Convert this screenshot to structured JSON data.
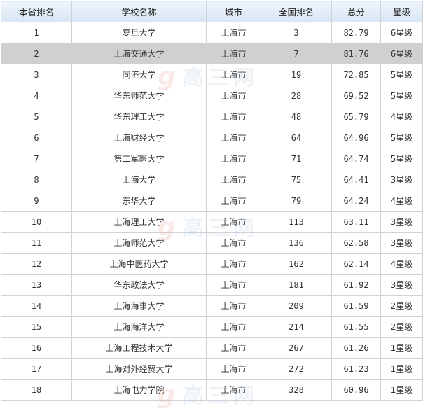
{
  "table": {
    "headers": [
      "本省排名",
      "学校名称",
      "城市",
      "全国排名",
      "总分",
      "星级"
    ],
    "rows": [
      {
        "prov": "1",
        "name": "复旦大学",
        "city": "上海市",
        "nat": "3",
        "score": "82.79",
        "star": "6星级"
      },
      {
        "prov": "2",
        "name": "上海交通大学",
        "city": "上海市",
        "nat": "7",
        "score": "81.76",
        "star": "6星级"
      },
      {
        "prov": "3",
        "name": "同济大学",
        "city": "上海市",
        "nat": "19",
        "score": "72.85",
        "star": "5星级"
      },
      {
        "prov": "4",
        "name": "华东师范大学",
        "city": "上海市",
        "nat": "28",
        "score": "69.52",
        "star": "5星级"
      },
      {
        "prov": "5",
        "name": "华东理工大学",
        "city": "上海市",
        "nat": "48",
        "score": "65.79",
        "star": "4星级"
      },
      {
        "prov": "6",
        "name": "上海财经大学",
        "city": "上海市",
        "nat": "64",
        "score": "64.96",
        "star": "5星级"
      },
      {
        "prov": "7",
        "name": "第二军医大学",
        "city": "上海市",
        "nat": "71",
        "score": "64.74",
        "star": "5星级"
      },
      {
        "prov": "8",
        "name": "上海大学",
        "city": "上海市",
        "nat": "75",
        "score": "64.41",
        "star": "3星级"
      },
      {
        "prov": "9",
        "name": "东华大学",
        "city": "上海市",
        "nat": "79",
        "score": "64.24",
        "star": "4星级"
      },
      {
        "prov": "10",
        "name": "上海理工大学",
        "city": "上海市",
        "nat": "113",
        "score": "63.11",
        "star": "3星级"
      },
      {
        "prov": "11",
        "name": "上海师范大学",
        "city": "上海市",
        "nat": "136",
        "score": "62.58",
        "star": "3星级"
      },
      {
        "prov": "12",
        "name": "上海中医药大学",
        "city": "上海市",
        "nat": "162",
        "score": "62.14",
        "star": "4星级"
      },
      {
        "prov": "13",
        "name": "华东政法大学",
        "city": "上海市",
        "nat": "181",
        "score": "61.92",
        "star": "3星级"
      },
      {
        "prov": "14",
        "name": "上海海事大学",
        "city": "上海市",
        "nat": "209",
        "score": "61.59",
        "star": "2星级"
      },
      {
        "prov": "15",
        "name": "上海海洋大学",
        "city": "上海市",
        "nat": "214",
        "score": "61.55",
        "star": "2星级"
      },
      {
        "prov": "16",
        "name": "上海工程技术大学",
        "city": "上海市",
        "nat": "267",
        "score": "61.26",
        "star": "1星级"
      },
      {
        "prov": "17",
        "name": "上海对外经贸大学",
        "city": "上海市",
        "nat": "272",
        "score": "61.23",
        "star": "1星级"
      },
      {
        "prov": "18",
        "name": "上海电力学院",
        "city": "上海市",
        "nat": "328",
        "score": "60.96",
        "star": "1星级"
      }
    ],
    "highlighted_row": 1
  },
  "watermark": {
    "text": "高三网",
    "glyph": "g"
  },
  "colors": {
    "header_bg": "#dce8f5",
    "border": "#cdd3d9",
    "highlight": "#d0d0d0"
  }
}
